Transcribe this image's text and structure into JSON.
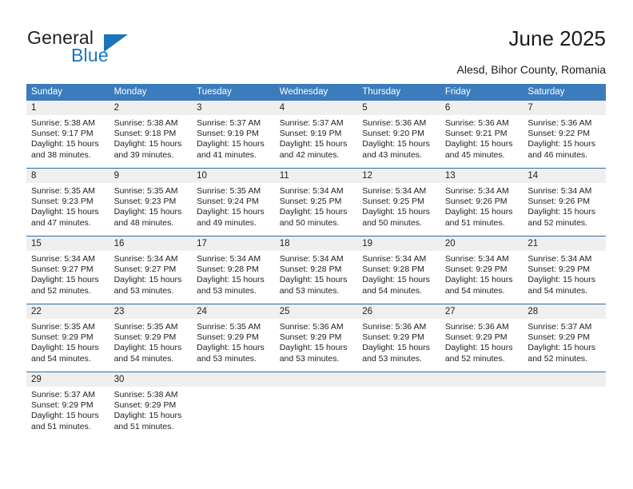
{
  "brand": {
    "name_part1": "General",
    "name_part2": "Blue",
    "accent_color": "#1b75bb",
    "triangle_icon": "triangle-icon"
  },
  "header": {
    "title": "June 2025",
    "location": "Alesd, Bihor County, Romania"
  },
  "theme": {
    "header_row_color": "#3b7cbd",
    "week_divider_color": "#2e6da4",
    "daynum_band_color": "#efefef",
    "text_color": "#222222"
  },
  "weekday_headers": [
    "Sunday",
    "Monday",
    "Tuesday",
    "Wednesday",
    "Thursday",
    "Friday",
    "Saturday"
  ],
  "weeks": [
    [
      {
        "day": "1",
        "sunrise": "Sunrise: 5:38 AM",
        "sunset": "Sunset: 9:17 PM",
        "daylight1": "Daylight: 15 hours",
        "daylight2": "and 38 minutes."
      },
      {
        "day": "2",
        "sunrise": "Sunrise: 5:38 AM",
        "sunset": "Sunset: 9:18 PM",
        "daylight1": "Daylight: 15 hours",
        "daylight2": "and 39 minutes."
      },
      {
        "day": "3",
        "sunrise": "Sunrise: 5:37 AM",
        "sunset": "Sunset: 9:19 PM",
        "daylight1": "Daylight: 15 hours",
        "daylight2": "and 41 minutes."
      },
      {
        "day": "4",
        "sunrise": "Sunrise: 5:37 AM",
        "sunset": "Sunset: 9:19 PM",
        "daylight1": "Daylight: 15 hours",
        "daylight2": "and 42 minutes."
      },
      {
        "day": "5",
        "sunrise": "Sunrise: 5:36 AM",
        "sunset": "Sunset: 9:20 PM",
        "daylight1": "Daylight: 15 hours",
        "daylight2": "and 43 minutes."
      },
      {
        "day": "6",
        "sunrise": "Sunrise: 5:36 AM",
        "sunset": "Sunset: 9:21 PM",
        "daylight1": "Daylight: 15 hours",
        "daylight2": "and 45 minutes."
      },
      {
        "day": "7",
        "sunrise": "Sunrise: 5:36 AM",
        "sunset": "Sunset: 9:22 PM",
        "daylight1": "Daylight: 15 hours",
        "daylight2": "and 46 minutes."
      }
    ],
    [
      {
        "day": "8",
        "sunrise": "Sunrise: 5:35 AM",
        "sunset": "Sunset: 9:23 PM",
        "daylight1": "Daylight: 15 hours",
        "daylight2": "and 47 minutes."
      },
      {
        "day": "9",
        "sunrise": "Sunrise: 5:35 AM",
        "sunset": "Sunset: 9:23 PM",
        "daylight1": "Daylight: 15 hours",
        "daylight2": "and 48 minutes."
      },
      {
        "day": "10",
        "sunrise": "Sunrise: 5:35 AM",
        "sunset": "Sunset: 9:24 PM",
        "daylight1": "Daylight: 15 hours",
        "daylight2": "and 49 minutes."
      },
      {
        "day": "11",
        "sunrise": "Sunrise: 5:34 AM",
        "sunset": "Sunset: 9:25 PM",
        "daylight1": "Daylight: 15 hours",
        "daylight2": "and 50 minutes."
      },
      {
        "day": "12",
        "sunrise": "Sunrise: 5:34 AM",
        "sunset": "Sunset: 9:25 PM",
        "daylight1": "Daylight: 15 hours",
        "daylight2": "and 50 minutes."
      },
      {
        "day": "13",
        "sunrise": "Sunrise: 5:34 AM",
        "sunset": "Sunset: 9:26 PM",
        "daylight1": "Daylight: 15 hours",
        "daylight2": "and 51 minutes."
      },
      {
        "day": "14",
        "sunrise": "Sunrise: 5:34 AM",
        "sunset": "Sunset: 9:26 PM",
        "daylight1": "Daylight: 15 hours",
        "daylight2": "and 52 minutes."
      }
    ],
    [
      {
        "day": "15",
        "sunrise": "Sunrise: 5:34 AM",
        "sunset": "Sunset: 9:27 PM",
        "daylight1": "Daylight: 15 hours",
        "daylight2": "and 52 minutes."
      },
      {
        "day": "16",
        "sunrise": "Sunrise: 5:34 AM",
        "sunset": "Sunset: 9:27 PM",
        "daylight1": "Daylight: 15 hours",
        "daylight2": "and 53 minutes."
      },
      {
        "day": "17",
        "sunrise": "Sunrise: 5:34 AM",
        "sunset": "Sunset: 9:28 PM",
        "daylight1": "Daylight: 15 hours",
        "daylight2": "and 53 minutes."
      },
      {
        "day": "18",
        "sunrise": "Sunrise: 5:34 AM",
        "sunset": "Sunset: 9:28 PM",
        "daylight1": "Daylight: 15 hours",
        "daylight2": "and 53 minutes."
      },
      {
        "day": "19",
        "sunrise": "Sunrise: 5:34 AM",
        "sunset": "Sunset: 9:28 PM",
        "daylight1": "Daylight: 15 hours",
        "daylight2": "and 54 minutes."
      },
      {
        "day": "20",
        "sunrise": "Sunrise: 5:34 AM",
        "sunset": "Sunset: 9:29 PM",
        "daylight1": "Daylight: 15 hours",
        "daylight2": "and 54 minutes."
      },
      {
        "day": "21",
        "sunrise": "Sunrise: 5:34 AM",
        "sunset": "Sunset: 9:29 PM",
        "daylight1": "Daylight: 15 hours",
        "daylight2": "and 54 minutes."
      }
    ],
    [
      {
        "day": "22",
        "sunrise": "Sunrise: 5:35 AM",
        "sunset": "Sunset: 9:29 PM",
        "daylight1": "Daylight: 15 hours",
        "daylight2": "and 54 minutes."
      },
      {
        "day": "23",
        "sunrise": "Sunrise: 5:35 AM",
        "sunset": "Sunset: 9:29 PM",
        "daylight1": "Daylight: 15 hours",
        "daylight2": "and 54 minutes."
      },
      {
        "day": "24",
        "sunrise": "Sunrise: 5:35 AM",
        "sunset": "Sunset: 9:29 PM",
        "daylight1": "Daylight: 15 hours",
        "daylight2": "and 53 minutes."
      },
      {
        "day": "25",
        "sunrise": "Sunrise: 5:36 AM",
        "sunset": "Sunset: 9:29 PM",
        "daylight1": "Daylight: 15 hours",
        "daylight2": "and 53 minutes."
      },
      {
        "day": "26",
        "sunrise": "Sunrise: 5:36 AM",
        "sunset": "Sunset: 9:29 PM",
        "daylight1": "Daylight: 15 hours",
        "daylight2": "and 53 minutes."
      },
      {
        "day": "27",
        "sunrise": "Sunrise: 5:36 AM",
        "sunset": "Sunset: 9:29 PM",
        "daylight1": "Daylight: 15 hours",
        "daylight2": "and 52 minutes."
      },
      {
        "day": "28",
        "sunrise": "Sunrise: 5:37 AM",
        "sunset": "Sunset: 9:29 PM",
        "daylight1": "Daylight: 15 hours",
        "daylight2": "and 52 minutes."
      }
    ],
    [
      {
        "day": "29",
        "sunrise": "Sunrise: 5:37 AM",
        "sunset": "Sunset: 9:29 PM",
        "daylight1": "Daylight: 15 hours",
        "daylight2": "and 51 minutes."
      },
      {
        "day": "30",
        "sunrise": "Sunrise: 5:38 AM",
        "sunset": "Sunset: 9:29 PM",
        "daylight1": "Daylight: 15 hours",
        "daylight2": "and 51 minutes."
      },
      {
        "day": "",
        "sunrise": "",
        "sunset": "",
        "daylight1": "",
        "daylight2": ""
      },
      {
        "day": "",
        "sunrise": "",
        "sunset": "",
        "daylight1": "",
        "daylight2": ""
      },
      {
        "day": "",
        "sunrise": "",
        "sunset": "",
        "daylight1": "",
        "daylight2": ""
      },
      {
        "day": "",
        "sunrise": "",
        "sunset": "",
        "daylight1": "",
        "daylight2": ""
      },
      {
        "day": "",
        "sunrise": "",
        "sunset": "",
        "daylight1": "",
        "daylight2": ""
      }
    ]
  ]
}
